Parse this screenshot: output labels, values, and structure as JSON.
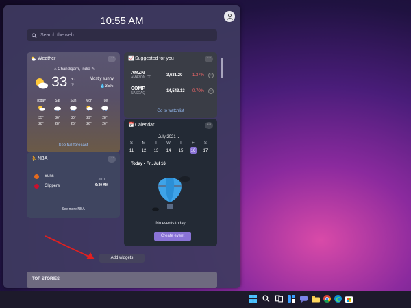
{
  "clock": "10:55 AM",
  "search": {
    "placeholder": "Search the web"
  },
  "weather": {
    "title": "Weather",
    "location": "Chandigarh, India",
    "temp": "33",
    "unit_c": "°C",
    "unit_f": "°F",
    "condition": "Mostly sunny",
    "precip": "35%",
    "forecast": [
      {
        "day": "Today",
        "high": "35°",
        "low": "28°"
      },
      {
        "day": "Sat",
        "high": "36°",
        "low": "28°"
      },
      {
        "day": "Sun",
        "high": "30°",
        "low": "26°"
      },
      {
        "day": "Mon",
        "high": "29°",
        "low": "26°"
      },
      {
        "day": "Tue",
        "high": "28°",
        "low": "26°"
      }
    ],
    "link": "See full forecast"
  },
  "nba": {
    "title": "NBA",
    "team1": "Suns",
    "team2": "Clippers",
    "date": "Jul 1",
    "time": "6:30 AM",
    "link": "See more NBA"
  },
  "suggested": {
    "title": "Suggested for you",
    "stocks": [
      {
        "symbol": "AMZN",
        "name": "AMAZON.CO...",
        "price": "3,631.20",
        "change": "-1.37%"
      },
      {
        "symbol": "COMP",
        "name": "NASDAQ",
        "price": "14,543.13",
        "change": "-0.70%"
      }
    ],
    "link": "Go to watchlist"
  },
  "calendar": {
    "title": "Calendar",
    "month": "July 2021",
    "weekdays": [
      "S",
      "M",
      "T",
      "W",
      "T",
      "F",
      "S"
    ],
    "days": [
      "11",
      "12",
      "13",
      "14",
      "15",
      "16",
      "17"
    ],
    "today_heading": "Today • Fri, Jul 16",
    "empty": "No events today",
    "create": "Create event"
  },
  "add_widgets": "Add widgets",
  "top_stories": "TOP STORIES",
  "colors": {
    "accent": "#8a73d6",
    "negative": "#ff6b6b",
    "link": "#9cc4ff"
  }
}
